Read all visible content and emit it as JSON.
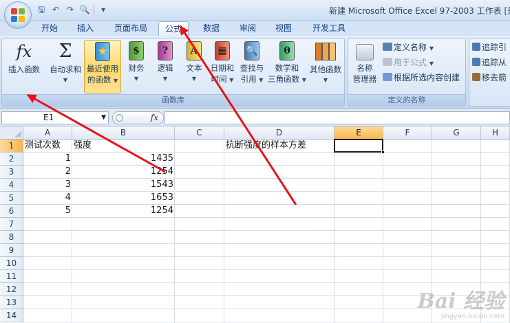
{
  "window": {
    "title": "新建 Microsoft Office Excel 97-2003 工作表 [兼"
  },
  "quick_access": [
    {
      "icon": "save-icon",
      "glyph": "🖫"
    },
    {
      "icon": "undo-icon",
      "glyph": "↶"
    },
    {
      "icon": "redo-icon",
      "glyph": "↷"
    },
    {
      "icon": "print-preview-icon",
      "glyph": "🔍"
    },
    {
      "icon": "customize-icon",
      "glyph": "▾"
    }
  ],
  "tabs": [
    "开始",
    "插入",
    "页面布局",
    "公式",
    "数据",
    "审阅",
    "视图",
    "开发工具"
  ],
  "active_tab": "公式",
  "ribbon": {
    "function_library": {
      "label": "函数库",
      "insert_function": "插入函数",
      "autosum": "自动求和",
      "recent": [
        "最近使用",
        "的函数"
      ],
      "financial": "财务",
      "logical": "逻辑",
      "text": "文本",
      "datetime": [
        "日期和",
        "时间"
      ],
      "lookup": [
        "查找与",
        "引用"
      ],
      "math": [
        "数学和",
        "三角函数"
      ],
      "more": "其他函数"
    },
    "defined_names": {
      "label": "定义的名称",
      "name_manager": [
        "名称",
        "管理器"
      ],
      "define_name": "定义名称",
      "use_in_formula": "用于公式",
      "create_from_selection": "根据所选内容创建"
    },
    "formula_auditing": {
      "trace_precedents": "追踪引",
      "trace_dependents": "追踪从",
      "remove_arrows": "移去箭"
    }
  },
  "formula_bar": {
    "name_box": "E1",
    "fx_label": "fx",
    "formula": ""
  },
  "sheet": {
    "columns": [
      "A",
      "B",
      "C",
      "D",
      "E",
      "F",
      "G",
      "H"
    ],
    "rows": [
      "1",
      "2",
      "3",
      "4",
      "5",
      "6",
      "7",
      "8",
      "9",
      "10",
      "11",
      "12",
      "13",
      "14"
    ],
    "selected_column": "E",
    "selected_row": "1",
    "active_cell": "E1",
    "cells": {
      "A1": "测试次数",
      "B1": "强度",
      "D1": "抗断强度的样本方差",
      "A2": "1",
      "B2": "1435",
      "A3": "2",
      "B3": "1254",
      "A4": "3",
      "B4": "1543",
      "A5": "4",
      "B5": "1653",
      "A6": "5",
      "B6": "1254"
    }
  },
  "watermark": {
    "brand": "Bai 经验",
    "url": "jingyan.baidu.com"
  },
  "colors": {
    "accent": "#15428b",
    "selection_header": "#f7b84c",
    "annotation_arrow": "#e8141b"
  }
}
